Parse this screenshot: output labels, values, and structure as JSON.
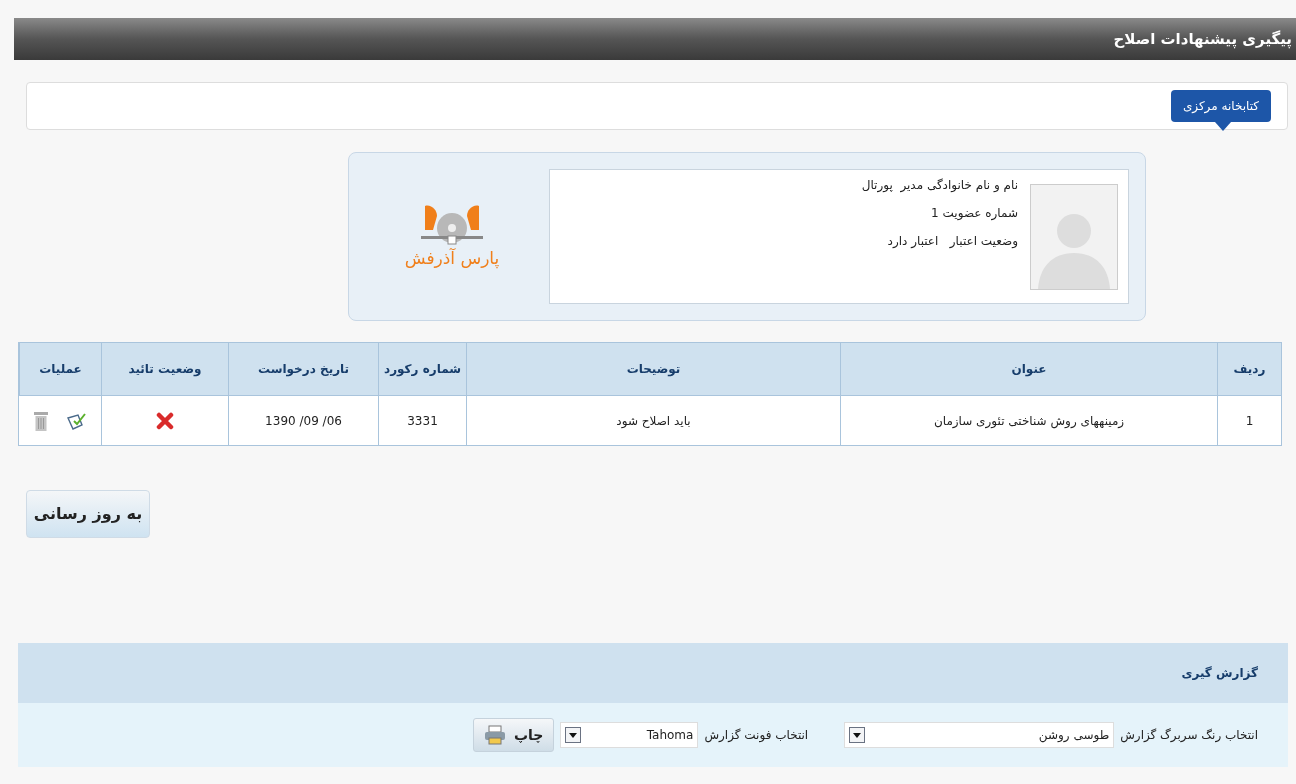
{
  "title": "پیگیری پیشنهادات اصلاح",
  "library_tab": {
    "label": "کتابخانه مرکزی"
  },
  "profile": {
    "lines": [
      "نام و نام خانوادگی مدیر  پورتال",
      "شماره عضویت 1",
      "وضعیت اعتبار   اعتبار دارد"
    ],
    "logo_text": "پارس آذرفش"
  },
  "table": {
    "columns": [
      "ردیف",
      "عنوان",
      "توضیحات",
      "شماره رکورد",
      "تاریخ درخواست",
      "وضعیت تائید",
      "عملیات"
    ],
    "rows": [
      {
        "index": "1",
        "title": "زمینههای روش شناختی تئوری سازمان",
        "description": "باید اصلاح شود",
        "record": "3331",
        "date": "1390 /09 /06",
        "approved": false
      }
    ]
  },
  "update_button": "به روز رسانی",
  "report": {
    "title": "گزارش گیری",
    "color_label": "انتخاب رنگ سربرگ گزارش",
    "color_value": "طوسی روشن",
    "font_label": "انتخاب فونت گزارش",
    "font_value": "Tahoma",
    "print_button": "چاپ"
  }
}
